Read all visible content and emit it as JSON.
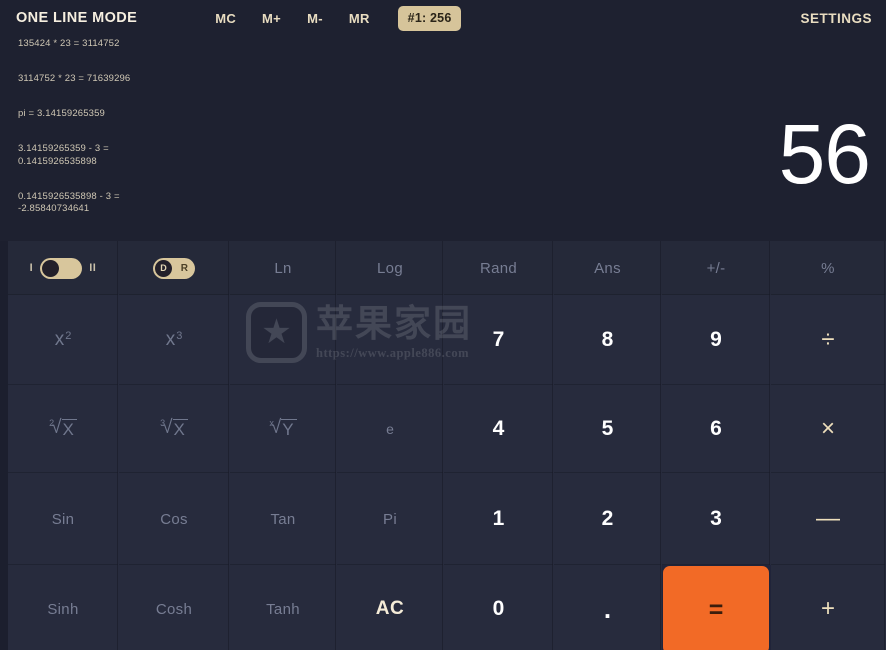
{
  "topbar": {
    "mode_title": "ONE LINE MODE",
    "memory_buttons": [
      {
        "label": "MC",
        "name": "memory-clear"
      },
      {
        "label": "M+",
        "name": "memory-add"
      },
      {
        "label": "M-",
        "name": "memory-subtract"
      },
      {
        "label": "MR",
        "name": "memory-recall"
      }
    ],
    "memory_badge": "#1: 256",
    "settings_label": "SETTINGS"
  },
  "display": {
    "current_value": "56",
    "history": [
      "135424 * 23 = 3114752",
      "3114752 * 23 = 71639296",
      "pi = 3.14159265359",
      "3.14159265359 - 3 =\n0.1415926535898",
      "0.1415926535898 - 3 =\n-2.85840734641"
    ]
  },
  "toggles": {
    "mode_toggle": {
      "left_label": "I",
      "right_label": "II",
      "knob_label": ""
    },
    "angle_toggle": {
      "knob_label": "D",
      "right_label": "R"
    }
  },
  "keypad": {
    "row1": [
      {
        "label": "Ln",
        "name": "key-ln",
        "style": "dim"
      },
      {
        "label": "Log",
        "name": "key-log",
        "style": "dim"
      },
      {
        "label": "Rand",
        "name": "key-rand",
        "style": "dim"
      },
      {
        "label": "Ans",
        "name": "key-ans",
        "style": "dim"
      },
      {
        "label": "+/-",
        "name": "key-sign",
        "style": "dim"
      },
      {
        "label": "%",
        "name": "key-percent",
        "style": "dim"
      }
    ],
    "row2": [
      {
        "label": "x",
        "sup": "2",
        "name": "key-square",
        "style": "pow"
      },
      {
        "label": "x",
        "sup": "3",
        "name": "key-cube",
        "style": "pow"
      },
      {
        "label": "7",
        "name": "key-7",
        "style": "num"
      },
      {
        "label": "8",
        "name": "key-8",
        "style": "num"
      },
      {
        "label": "9",
        "name": "key-9",
        "style": "num"
      },
      {
        "label": "÷",
        "name": "key-divide",
        "style": "op"
      }
    ],
    "row3": [
      {
        "label": "X",
        "idx": "2",
        "name": "key-sqrt",
        "style": "radical"
      },
      {
        "label": "X",
        "idx": "3",
        "name": "key-cbrt",
        "style": "radical"
      },
      {
        "label": "Y",
        "idx": "x",
        "name": "key-nthroot",
        "style": "radical"
      },
      {
        "label": "e",
        "name": "key-e",
        "style": "dim"
      },
      {
        "label": "4",
        "name": "key-4",
        "style": "num"
      },
      {
        "label": "5",
        "name": "key-5",
        "style": "num"
      },
      {
        "label": "6",
        "name": "key-6",
        "style": "num"
      },
      {
        "label": "×",
        "name": "key-multiply",
        "style": "op"
      }
    ],
    "row4": [
      {
        "label": "Sin",
        "name": "key-sin",
        "style": "dim"
      },
      {
        "label": "Cos",
        "name": "key-cos",
        "style": "dim"
      },
      {
        "label": "Tan",
        "name": "key-tan",
        "style": "dim"
      },
      {
        "label": "Pi",
        "name": "key-pi",
        "style": "dim"
      },
      {
        "label": "1",
        "name": "key-1",
        "style": "num"
      },
      {
        "label": "2",
        "name": "key-2",
        "style": "num"
      },
      {
        "label": "3",
        "name": "key-3",
        "style": "num"
      },
      {
        "label": "—",
        "name": "key-minus",
        "style": "op"
      }
    ],
    "row5": [
      {
        "label": "Sinh",
        "name": "key-sinh",
        "style": "dim"
      },
      {
        "label": "Cosh",
        "name": "key-cosh",
        "style": "dim"
      },
      {
        "label": "Tanh",
        "name": "key-tanh",
        "style": "dim"
      },
      {
        "label": "AC",
        "name": "key-ac",
        "style": "ac"
      },
      {
        "label": "0",
        "name": "key-0",
        "style": "num"
      },
      {
        "label": ".",
        "name": "key-decimal",
        "style": "dot"
      },
      {
        "label": "=",
        "name": "key-equals",
        "style": "equals"
      },
      {
        "label": "+",
        "name": "key-plus",
        "style": "op"
      }
    ]
  },
  "watermark": {
    "star_glyph": "★",
    "chinese_text": "苹果家园",
    "url": "https://www.apple886.com"
  },
  "colors": {
    "background": "#1e2130",
    "key_background": "#272b3d",
    "accent_tan": "#d8c69c",
    "accent_orange": "#f26a26",
    "text_dim": "#777d93",
    "text_white": "#ffffff"
  }
}
